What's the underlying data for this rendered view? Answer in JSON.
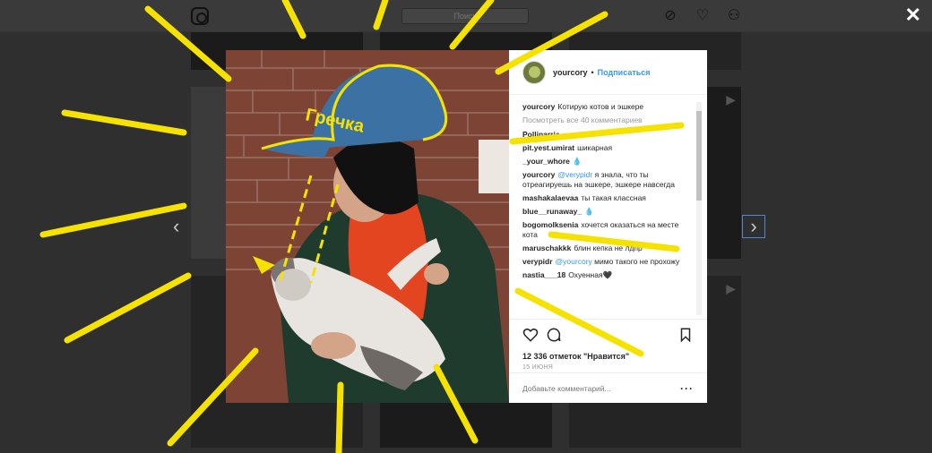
{
  "header": {
    "search_placeholder": "Поиск",
    "logo_icon": "instagram-logo-icon",
    "nav_icons": [
      "compass-icon",
      "heart-icon",
      "user-icon"
    ],
    "close_label": "✕"
  },
  "post": {
    "username": "yourcory",
    "dot": "•",
    "follow_label": "Подписаться",
    "view_all": "Посмотреть все 40 комментариев",
    "comments": [
      {
        "user": "yourcory",
        "text": "Котирую котов и эшкере"
      },
      {
        "user": "Pollinarria",
        "text": ""
      },
      {
        "user": "pit.yest.umirat",
        "text": "шикарная"
      },
      {
        "user": "_your_whore",
        "text": "💧"
      },
      {
        "user": "yourcory",
        "mention": "@verypidr",
        "text": "я знала, что ты отреагируешь на эшкере, эшкере навсегда"
      },
      {
        "user": "mashakalaevaa",
        "text": "ты такая классная"
      },
      {
        "user": "blue__runaway_",
        "text": "💧"
      },
      {
        "user": "bogomolksenia",
        "text": "хочется оказаться на месте кота"
      },
      {
        "user": "maruschakkk",
        "text": "блин кепка не лдпр"
      },
      {
        "user": "verypidr",
        "mention": "@yourcory",
        "text": "мимо такого не прохожу"
      },
      {
        "user": "nastia___18",
        "text": "Охуенная🖤"
      }
    ],
    "likes": "12 336 отметок \"Нравится\"",
    "date": "15 ИЮНЯ",
    "comment_placeholder": "Добавьте комментарий...",
    "more_label": "···",
    "cap_text": "Гречка"
  },
  "colors": {
    "accent": "#3897f0",
    "scribble": "#f5e200"
  }
}
